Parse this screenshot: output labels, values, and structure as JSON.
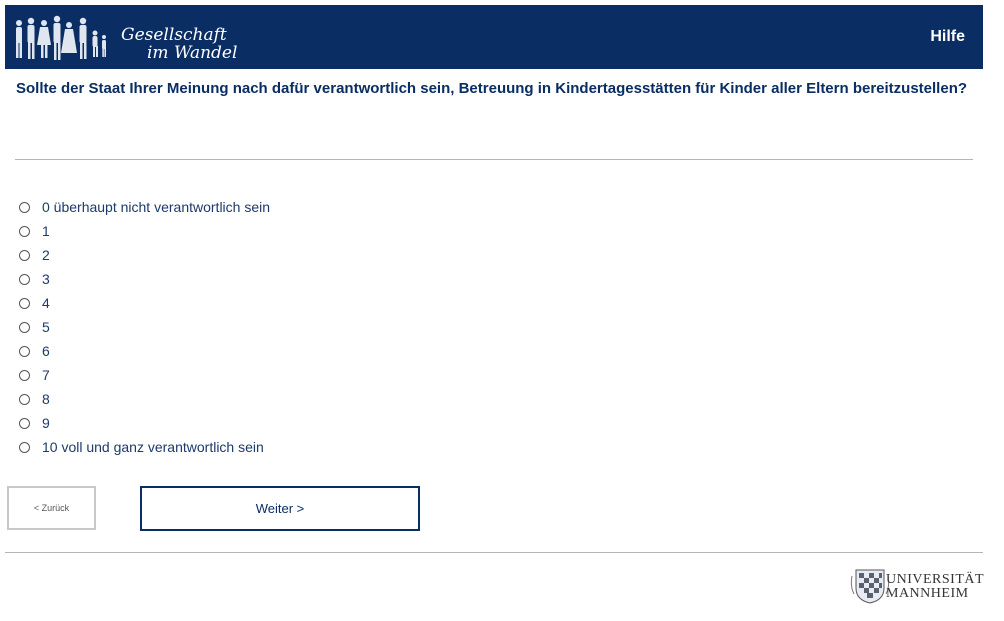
{
  "header": {
    "logo_line1": "Gesellschaft",
    "logo_line2": "im Wandel",
    "help_label": "Hilfe",
    "background_color": "#0a2d63"
  },
  "question": {
    "text": "Sollte der Staat Ihrer Meinung nach dafür verantwortlich sein, Betreuung in Kindertagesstätten für Kinder aller Eltern bereitzustellen?"
  },
  "options": [
    {
      "label": "0 überhaupt nicht verantwortlich sein",
      "selected": false
    },
    {
      "label": "1",
      "selected": false
    },
    {
      "label": "2",
      "selected": false
    },
    {
      "label": "3",
      "selected": false
    },
    {
      "label": "4",
      "selected": false
    },
    {
      "label": "5",
      "selected": false
    },
    {
      "label": "6",
      "selected": false
    },
    {
      "label": "7",
      "selected": false
    },
    {
      "label": "8",
      "selected": false
    },
    {
      "label": "9",
      "selected": false
    },
    {
      "label": "10 voll und ganz verantwortlich sein",
      "selected": false
    }
  ],
  "nav": {
    "back_label": "< Zurück",
    "next_label": "Weiter >"
  },
  "footer": {
    "university_line1": "UNIVERSITÄT",
    "university_line2": "MANNHEIM"
  }
}
